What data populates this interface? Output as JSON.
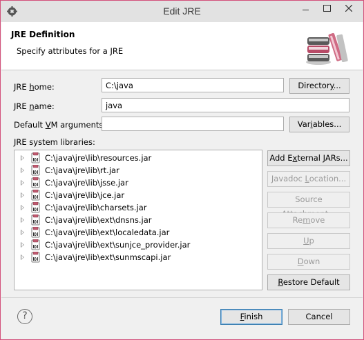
{
  "window": {
    "title": "Edit JRE"
  },
  "header": {
    "title": "JRE Definition",
    "subtitle": "Specify attributes for a JRE"
  },
  "form": {
    "jre_home": {
      "label_pre": "JRE ",
      "label_mn": "h",
      "label_post": "ome:",
      "value": "C:\\java"
    },
    "jre_name": {
      "label_pre": "JRE ",
      "label_mn": "n",
      "label_post": "ame:",
      "value": "java"
    },
    "vm_args": {
      "label_pre": "Default ",
      "label_mn": "V",
      "label_post": "M arguments:",
      "value": ""
    },
    "libraries_label": "JRE system libraries:"
  },
  "buttons": {
    "directory": {
      "pre": "Director",
      "mn": "y",
      "post": "..."
    },
    "variables": {
      "pre": "Var",
      "mn": "i",
      "post": "ables..."
    },
    "add_external_jars": {
      "pre": "Add E",
      "mn": "x",
      "post": "ternal JARs..."
    },
    "javadoc_location": {
      "pre": "Javadoc ",
      "mn": "L",
      "post": "ocation..."
    },
    "source_attachment": {
      "pre": "Source ",
      "mn": "A",
      "post": "ttachment..."
    },
    "remove": {
      "pre": "Re",
      "mn": "m",
      "post": "ove"
    },
    "up": {
      "pre": "",
      "mn": "U",
      "post": "p"
    },
    "down": {
      "pre": "",
      "mn": "D",
      "post": "own"
    },
    "restore_default": {
      "pre": "",
      "mn": "R",
      "post": "estore Default"
    },
    "finish": {
      "pre": "",
      "mn": "F",
      "post": "inish"
    },
    "cancel": {
      "pre": "Cancel",
      "mn": "",
      "post": ""
    }
  },
  "libraries": [
    "C:\\java\\jre\\lib\\resources.jar",
    "C:\\java\\jre\\lib\\rt.jar",
    "C:\\java\\jre\\lib\\jsse.jar",
    "C:\\java\\jre\\lib\\jce.jar",
    "C:\\java\\jre\\lib\\charsets.jar",
    "C:\\java\\jre\\lib\\ext\\dnsns.jar",
    "C:\\java\\jre\\lib\\ext\\localedata.jar",
    "C:\\java\\jre\\lib\\ext\\sunjce_provider.jar",
    "C:\\java\\jre\\lib\\ext\\sunmscapi.jar"
  ],
  "help_glyph": "?",
  "icons": [
    "app-icon",
    "minimize-icon",
    "maximize-icon",
    "close-icon",
    "jre-books-icon",
    "jar-file-icon",
    "help-icon"
  ]
}
